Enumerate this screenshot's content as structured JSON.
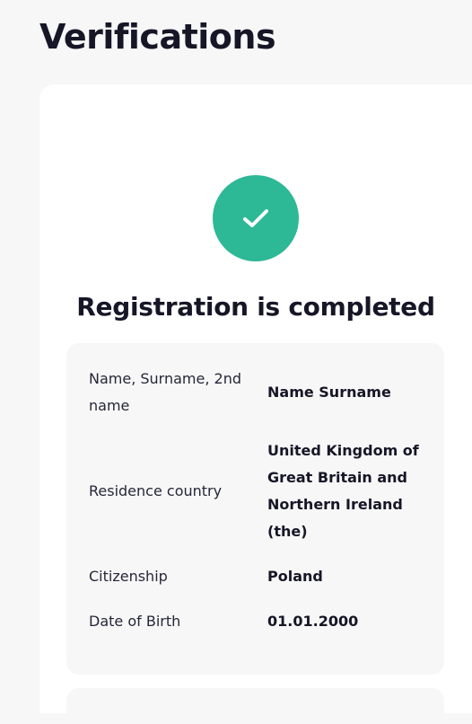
{
  "page": {
    "title": "Verifications"
  },
  "status": {
    "heading": "Registration is completed",
    "icon": "check-icon",
    "color": "#2db896"
  },
  "details": [
    {
      "label": "Name, Surname, 2nd name",
      "value": "Name Surname"
    },
    {
      "label": "Residence country",
      "value": "United Kingdom of Great Britain and Northern Ireland (the)"
    },
    {
      "label": "Citizenship",
      "value": "Poland"
    },
    {
      "label": "Date of Birth",
      "value": "01.01.2000"
    }
  ]
}
